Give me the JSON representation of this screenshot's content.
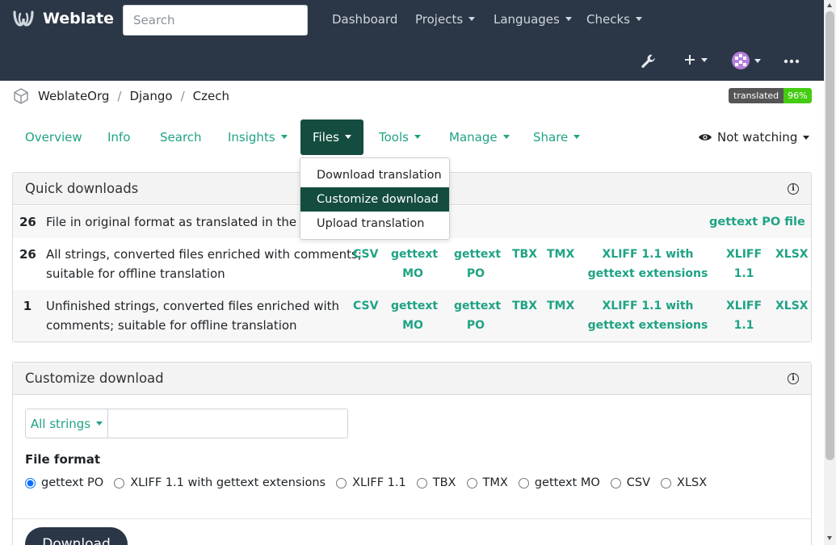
{
  "app": {
    "name": "Weblate"
  },
  "search": {
    "placeholder": "Search"
  },
  "nav": {
    "dashboard": "Dashboard",
    "projects": "Projects",
    "languages": "Languages",
    "checks": "Checks"
  },
  "breadcrumb": {
    "project": "WeblateOrg",
    "component": "Django",
    "language": "Czech"
  },
  "badge": {
    "label": "translated",
    "value": "96%"
  },
  "tabs": {
    "overview": "Overview",
    "info": "Info",
    "search": "Search",
    "insights": "Insights",
    "files": "Files",
    "tools": "Tools",
    "manage": "Manage",
    "share": "Share"
  },
  "watch": {
    "label": "Not watching"
  },
  "files_menu": {
    "items": [
      "Download translation",
      "Customize download",
      "Upload translation"
    ],
    "active": "Customize download"
  },
  "quick_downloads": {
    "title": "Quick downloads",
    "rows": [
      {
        "count": "26",
        "desc_line1": "File in original format as translated in the repository",
        "desc_line2": "",
        "formats": [
          "gettext PO file"
        ]
      },
      {
        "count": "26",
        "desc_line1": "All strings, converted files enriched with comments;",
        "desc_line2": "suitable for offline translation",
        "formats": [
          "CSV",
          "gettext MO",
          "gettext PO",
          "TBX",
          "TMX",
          "XLIFF 1.1 with gettext extensions",
          "XLIFF 1.1",
          "XLSX"
        ]
      },
      {
        "count": "1",
        "desc_line1": "Unfinished strings, converted files enriched with",
        "desc_line2": "comments; suitable for offline translation",
        "formats": [
          "CSV",
          "gettext MO",
          "gettext PO",
          "TBX",
          "TMX",
          "XLIFF 1.1 with gettext extensions",
          "XLIFF 1.1",
          "XLSX"
        ]
      }
    ]
  },
  "customize": {
    "title": "Customize download",
    "filter_label": "All strings",
    "query_value": "",
    "file_format_label": "File format",
    "formats": [
      "gettext PO",
      "XLIFF 1.1 with gettext extensions",
      "XLIFF 1.1",
      "TBX",
      "TMX",
      "gettext MO",
      "CSV",
      "XLSX"
    ],
    "selected": "gettext PO",
    "download_label": "Download"
  },
  "colors": {
    "navbar": "#2b3746",
    "accent": "#1fa385",
    "active_tab": "#144d3f",
    "badge_green": "#44cc11"
  }
}
